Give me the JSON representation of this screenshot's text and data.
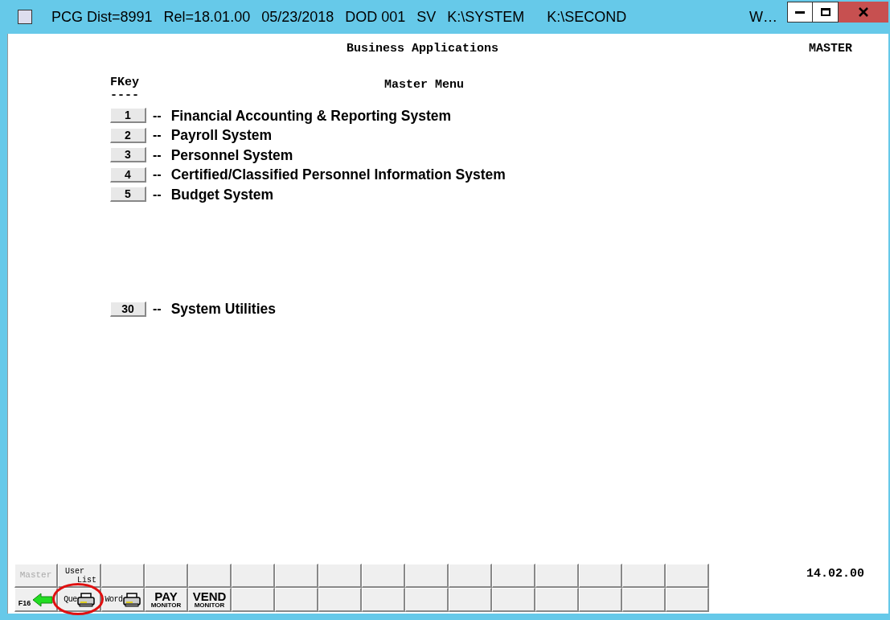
{
  "window": {
    "title_parts": [
      "PCG Dist=8991",
      "Rel=18.01.00",
      "05/23/2018",
      "DOD 001",
      "SV",
      "K:\\SYSTEM",
      "K:\\SECOND"
    ],
    "title_cut": "W…"
  },
  "screen": {
    "heading": "Business Applications",
    "mode": "MASTER",
    "key_heading": "FKey",
    "key_rule": "----",
    "menu_title": "Master Menu",
    "time": "14.02.00"
  },
  "menu_groups": [
    [
      {
        "key": "1",
        "separator": "--",
        "label": "Financial Accounting & Reporting System"
      },
      {
        "key": "2",
        "separator": "--",
        "label": "Payroll System"
      },
      {
        "key": "3",
        "separator": "--",
        "label": "Personnel System"
      },
      {
        "key": "4",
        "separator": "--",
        "label": "Certified/Classified Personnel Information System"
      },
      {
        "key": "5",
        "separator": "--",
        "label": "Budget System"
      }
    ],
    [
      {
        "key": "30",
        "separator": "--",
        "label": "System Utilities"
      }
    ]
  ],
  "toolbar_rows": [
    [
      {
        "kind": "text",
        "label": "Master",
        "disabled": true
      },
      {
        "kind": "stacked",
        "lines": [
          "User",
          "List"
        ]
      },
      {
        "kind": "empty"
      },
      {
        "kind": "empty"
      },
      {
        "kind": "empty"
      },
      {
        "kind": "empty"
      },
      {
        "kind": "empty"
      },
      {
        "kind": "empty"
      },
      {
        "kind": "empty"
      },
      {
        "kind": "empty"
      },
      {
        "kind": "empty"
      },
      {
        "kind": "empty"
      },
      {
        "kind": "empty"
      },
      {
        "kind": "empty"
      },
      {
        "kind": "empty"
      },
      {
        "kind": "empty"
      }
    ],
    [
      {
        "kind": "arrow",
        "label": "F16"
      },
      {
        "kind": "print",
        "label": "Que",
        "circled": true
      },
      {
        "kind": "print",
        "label": "Word",
        "circled": false
      },
      {
        "kind": "monitor",
        "label": "PAY",
        "sub": "MONITOR"
      },
      {
        "kind": "monitor",
        "label": "VEND",
        "sub": "MONITOR"
      },
      {
        "kind": "empty"
      },
      {
        "kind": "empty"
      },
      {
        "kind": "empty"
      },
      {
        "kind": "empty"
      },
      {
        "kind": "empty"
      },
      {
        "kind": "empty"
      },
      {
        "kind": "empty"
      },
      {
        "kind": "empty"
      },
      {
        "kind": "empty"
      },
      {
        "kind": "empty"
      },
      {
        "kind": "empty"
      }
    ]
  ]
}
